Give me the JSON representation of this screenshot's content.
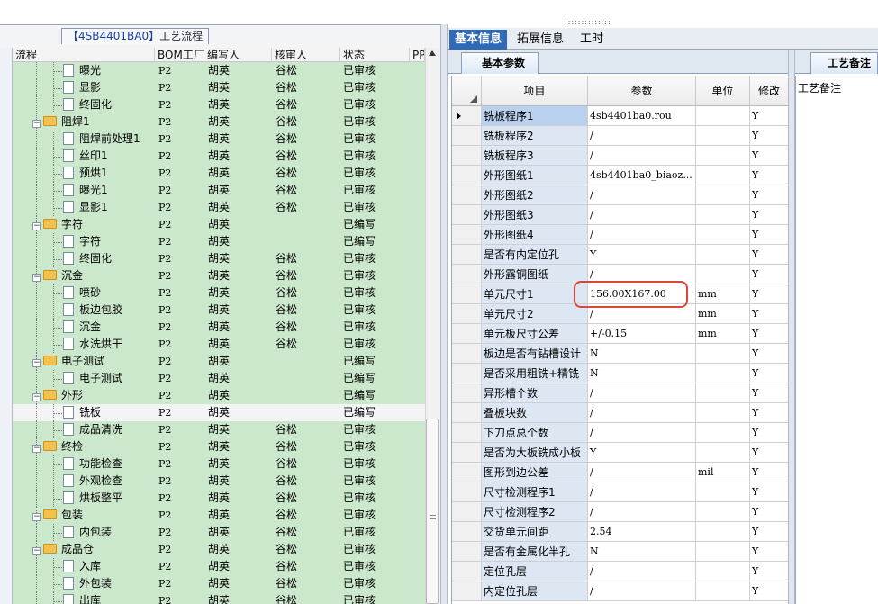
{
  "left": {
    "title_prefix": "【4SB4401BA0】",
    "title_suffix": "工艺流程",
    "headers": [
      "流程",
      "BOM工厂",
      "编写人",
      "核审人",
      "状态",
      "PP"
    ],
    "rows": [
      {
        "name": "曝光",
        "level": 2,
        "type": "doc",
        "plant": "P2",
        "author": "胡英",
        "reviewer": "谷松",
        "status": "已审核"
      },
      {
        "name": "显影",
        "level": 2,
        "type": "doc",
        "plant": "P2",
        "author": "胡英",
        "reviewer": "谷松",
        "status": "已审核"
      },
      {
        "name": "终固化",
        "level": 2,
        "type": "doc",
        "plant": "P2",
        "author": "胡英",
        "reviewer": "谷松",
        "status": "已审核"
      },
      {
        "name": "阻焊1",
        "level": 1,
        "type": "folder",
        "plant": "P2",
        "author": "胡英",
        "reviewer": "谷松",
        "status": "已审核"
      },
      {
        "name": "阻焊前处理1",
        "level": 2,
        "type": "doc",
        "plant": "P2",
        "author": "胡英",
        "reviewer": "谷松",
        "status": "已审核"
      },
      {
        "name": "丝印1",
        "level": 2,
        "type": "doc",
        "plant": "P2",
        "author": "胡英",
        "reviewer": "谷松",
        "status": "已审核"
      },
      {
        "name": "预烘1",
        "level": 2,
        "type": "doc",
        "plant": "P2",
        "author": "胡英",
        "reviewer": "谷松",
        "status": "已审核"
      },
      {
        "name": "曝光1",
        "level": 2,
        "type": "doc",
        "plant": "P2",
        "author": "胡英",
        "reviewer": "谷松",
        "status": "已审核"
      },
      {
        "name": "显影1",
        "level": 2,
        "type": "doc",
        "plant": "P2",
        "author": "胡英",
        "reviewer": "谷松",
        "status": "已审核"
      },
      {
        "name": "字符",
        "level": 1,
        "type": "folder",
        "plant": "P2",
        "author": "胡英",
        "reviewer": "",
        "status": "已编写"
      },
      {
        "name": "字符",
        "level": 2,
        "type": "doc",
        "plant": "P2",
        "author": "胡英",
        "reviewer": "",
        "status": "已编写"
      },
      {
        "name": "终固化",
        "level": 2,
        "type": "doc",
        "plant": "P2",
        "author": "胡英",
        "reviewer": "谷松",
        "status": "已审核"
      },
      {
        "name": "沉金",
        "level": 1,
        "type": "folder",
        "plant": "P2",
        "author": "胡英",
        "reviewer": "谷松",
        "status": "已审核"
      },
      {
        "name": "喷砂",
        "level": 2,
        "type": "doc",
        "plant": "P2",
        "author": "胡英",
        "reviewer": "谷松",
        "status": "已审核"
      },
      {
        "name": "板边包胶",
        "level": 2,
        "type": "doc",
        "plant": "P2",
        "author": "胡英",
        "reviewer": "谷松",
        "status": "已审核"
      },
      {
        "name": "沉金",
        "level": 2,
        "type": "doc",
        "plant": "P2",
        "author": "胡英",
        "reviewer": "谷松",
        "status": "已审核"
      },
      {
        "name": "水洗烘干",
        "level": 2,
        "type": "doc",
        "plant": "P2",
        "author": "胡英",
        "reviewer": "谷松",
        "status": "已审核"
      },
      {
        "name": "电子测试",
        "level": 1,
        "type": "folder",
        "plant": "P2",
        "author": "胡英",
        "reviewer": "",
        "status": "已编写"
      },
      {
        "name": "电子测试",
        "level": 2,
        "type": "doc",
        "plant": "P2",
        "author": "胡英",
        "reviewer": "",
        "status": "已编写"
      },
      {
        "name": "外形",
        "level": 1,
        "type": "folder",
        "plant": "P2",
        "author": "胡英",
        "reviewer": "",
        "status": "已编写"
      },
      {
        "name": "铣板",
        "level": 2,
        "type": "doc",
        "plant": "P2",
        "author": "胡英",
        "reviewer": "",
        "status": "已编写",
        "selected": true
      },
      {
        "name": "成品清洗",
        "level": 2,
        "type": "doc",
        "plant": "P2",
        "author": "胡英",
        "reviewer": "谷松",
        "status": "已审核"
      },
      {
        "name": "终检",
        "level": 1,
        "type": "folder",
        "plant": "P2",
        "author": "胡英",
        "reviewer": "谷松",
        "status": "已审核"
      },
      {
        "name": "功能检查",
        "level": 2,
        "type": "doc",
        "plant": "P2",
        "author": "胡英",
        "reviewer": "谷松",
        "status": "已审核"
      },
      {
        "name": "外观检查",
        "level": 2,
        "type": "doc",
        "plant": "P2",
        "author": "胡英",
        "reviewer": "谷松",
        "status": "已审核"
      },
      {
        "name": "烘板整平",
        "level": 2,
        "type": "doc",
        "plant": "P2",
        "author": "胡英",
        "reviewer": "谷松",
        "status": "已审核"
      },
      {
        "name": "包装",
        "level": 1,
        "type": "folder",
        "plant": "P2",
        "author": "胡英",
        "reviewer": "谷松",
        "status": "已审核"
      },
      {
        "name": "内包装",
        "level": 2,
        "type": "doc",
        "plant": "P2",
        "author": "胡英",
        "reviewer": "谷松",
        "status": "已审核"
      },
      {
        "name": "成品仓",
        "level": 1,
        "type": "folder",
        "plant": "P2",
        "author": "胡英",
        "reviewer": "谷松",
        "status": "已审核"
      },
      {
        "name": "入库",
        "level": 2,
        "type": "doc",
        "plant": "P2",
        "author": "胡英",
        "reviewer": "谷松",
        "status": "已审核"
      },
      {
        "name": "外包装",
        "level": 2,
        "type": "doc",
        "plant": "P2",
        "author": "胡英",
        "reviewer": "谷松",
        "status": "已审核"
      },
      {
        "name": "出库",
        "level": 2,
        "type": "doc",
        "plant": "P2",
        "author": "胡英",
        "reviewer": "谷松",
        "status": "已审核"
      }
    ]
  },
  "right": {
    "tabs": [
      "基本信息",
      "拓展信息",
      "工时"
    ],
    "active_tab": "基本信息",
    "sub_tab": "基本参数",
    "headers": [
      "项目",
      "参数",
      "单位",
      "修改"
    ],
    "rows": [
      {
        "item": "铣板程序1",
        "param": "4sb4401ba0.rou",
        "unit": "",
        "mod": "Y"
      },
      {
        "item": "铣板程序2",
        "param": "/",
        "unit": "",
        "mod": "Y"
      },
      {
        "item": "铣板程序3",
        "param": "/",
        "unit": "",
        "mod": "Y"
      },
      {
        "item": "外形图纸1",
        "param": "4sb4401ba0_biaoz...",
        "unit": "",
        "mod": "Y"
      },
      {
        "item": "外形图纸2",
        "param": "/",
        "unit": "",
        "mod": "Y"
      },
      {
        "item": "外形图纸3",
        "param": "/",
        "unit": "",
        "mod": "Y"
      },
      {
        "item": "外形图纸4",
        "param": "/",
        "unit": "",
        "mod": "Y"
      },
      {
        "item": "是否有内定位孔",
        "param": "Y",
        "unit": "",
        "mod": "Y"
      },
      {
        "item": "外形露铜图纸",
        "param": "/",
        "unit": "",
        "mod": "Y"
      },
      {
        "item": "单元尺寸1",
        "param": "156.00X167.00",
        "unit": "mm",
        "mod": "Y"
      },
      {
        "item": "单元尺寸2",
        "param": "/",
        "unit": "mm",
        "mod": "Y"
      },
      {
        "item": "单元板尺寸公差",
        "param": "+/-0.15",
        "unit": "mm",
        "mod": "Y"
      },
      {
        "item": "板边是否有钻槽设计",
        "param": "N",
        "unit": "",
        "mod": "Y"
      },
      {
        "item": "是否采用粗铣+精铣",
        "param": "N",
        "unit": "",
        "mod": "Y"
      },
      {
        "item": "异形槽个数",
        "param": "/",
        "unit": "",
        "mod": "Y"
      },
      {
        "item": "叠板块数",
        "param": "/",
        "unit": "",
        "mod": "Y"
      },
      {
        "item": "下刀点总个数",
        "param": "/",
        "unit": "",
        "mod": "Y"
      },
      {
        "item": "是否为大板铣成小板",
        "param": "Y",
        "unit": "",
        "mod": "Y"
      },
      {
        "item": "图形到边公差",
        "param": "/",
        "unit": "mil",
        "mod": "Y"
      },
      {
        "item": "尺寸检测程序1",
        "param": "/",
        "unit": "",
        "mod": "Y"
      },
      {
        "item": "尺寸检测程序2",
        "param": "/",
        "unit": "",
        "mod": "Y"
      },
      {
        "item": "交货单元间距",
        "param": "2.54",
        "unit": "",
        "mod": "Y"
      },
      {
        "item": "是否有金属化半孔",
        "param": "N",
        "unit": "",
        "mod": "Y"
      },
      {
        "item": "定位孔层",
        "param": "/",
        "unit": "",
        "mod": "Y"
      },
      {
        "item": "内定位孔层",
        "param": "/",
        "unit": "",
        "mod": "Y"
      }
    ]
  },
  "remark": {
    "tab": "工艺备注",
    "label": "工艺备注"
  }
}
